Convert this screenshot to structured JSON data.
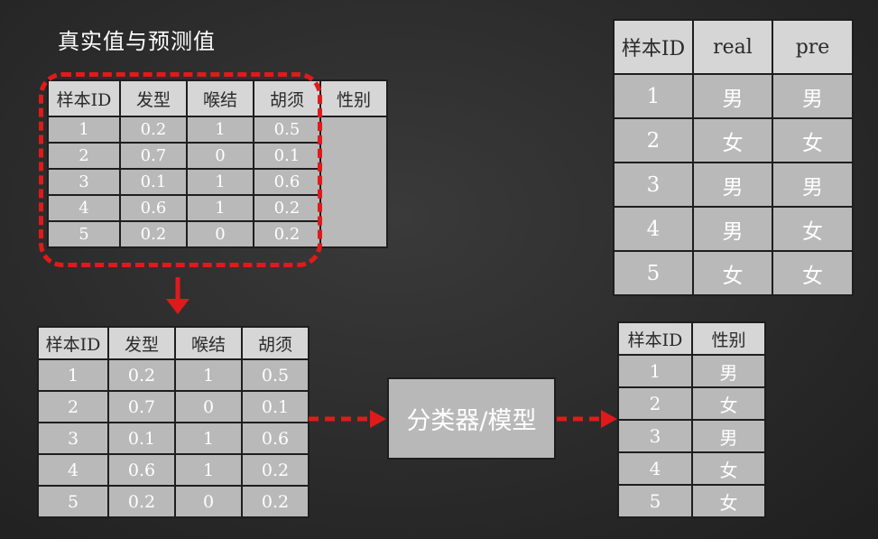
{
  "title": "真实值与预测值",
  "table_input": {
    "headers": [
      "样本ID",
      "发型",
      "喉结",
      "胡须",
      "性别"
    ],
    "rows": [
      [
        "1",
        "0.2",
        "1",
        "0.5"
      ],
      [
        "2",
        "0.7",
        "0",
        "0.1"
      ],
      [
        "3",
        "0.1",
        "1",
        "0.6"
      ],
      [
        "4",
        "0.6",
        "1",
        "0.2"
      ],
      [
        "5",
        "0.2",
        "0",
        "0.2"
      ]
    ]
  },
  "table_features": {
    "headers": [
      "样本ID",
      "发型",
      "喉结",
      "胡须"
    ],
    "rows": [
      [
        "1",
        "0.2",
        "1",
        "0.5"
      ],
      [
        "2",
        "0.7",
        "0",
        "0.1"
      ],
      [
        "3",
        "0.1",
        "1",
        "0.6"
      ],
      [
        "4",
        "0.6",
        "1",
        "0.2"
      ],
      [
        "5",
        "0.2",
        "0",
        "0.2"
      ]
    ]
  },
  "classifier_label": "分类器/模型",
  "table_output": {
    "headers": [
      "样本ID",
      "性别"
    ],
    "rows": [
      [
        "1",
        "男"
      ],
      [
        "2",
        "女"
      ],
      [
        "3",
        "男"
      ],
      [
        "4",
        "女"
      ],
      [
        "5",
        "女"
      ]
    ]
  },
  "table_compare": {
    "headers": [
      "样本ID",
      "real",
      "pre"
    ],
    "rows": [
      [
        "1",
        "男",
        "男"
      ],
      [
        "2",
        "女",
        "女"
      ],
      [
        "3",
        "男",
        "男"
      ],
      [
        "4",
        "男",
        "女"
      ],
      [
        "5",
        "女",
        "女"
      ]
    ]
  },
  "colors": {
    "highlight": "#e01a1a",
    "table_fill": "#b9b9b9",
    "header_fill": "#d6d6d6",
    "background": "#2b2b2b"
  }
}
